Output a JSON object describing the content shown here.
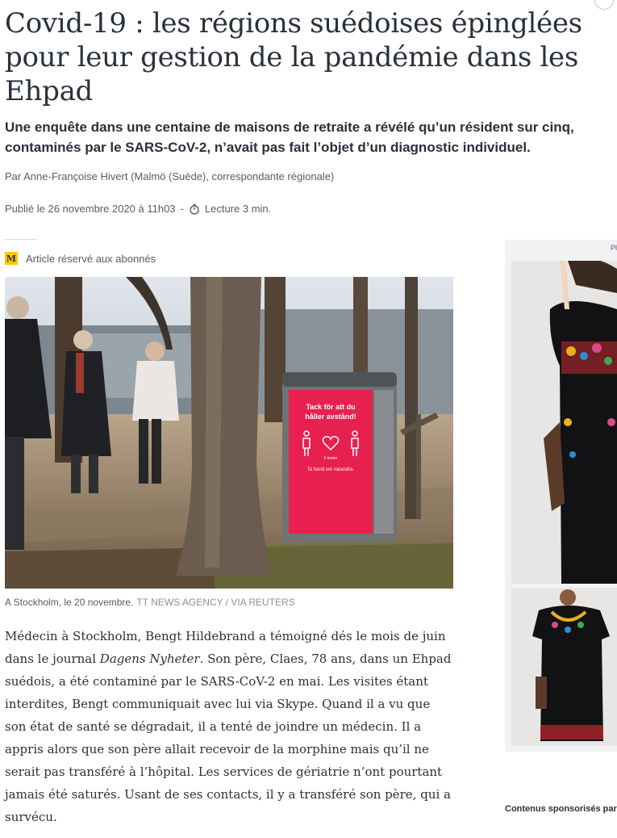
{
  "article": {
    "headline": "Covid-19 : les régions suédoises épinglées pour leur gestion de la pandémie dans les Ehpad",
    "standfirst": "Une enquête dans une centaine de maisons de retraite a révélé qu’un résident sur cinq, contaminés par le SARS-CoV-2, n’avait pas fait l’objet d’un diagnostic individuel.",
    "byline": "Par Anne-Françoise Hivert (Malmö (Suède), correspondante régionale)",
    "published": "Publié le 26 novembre 2020 à 11h03",
    "separator": "-",
    "reading_time": "Lecture 3 min.",
    "premium_badge": "M",
    "premium_label": "Article réservé aux abonnés"
  },
  "photo": {
    "caption": "A Stockholm, le 20 novembre.",
    "credit": "TT NEWS AGENCY / VIA REUTERS",
    "sign_text_1": "Tack för att du",
    "sign_text_2": "håller avstånd!",
    "sign_distance": "2 meter",
    "sign_text_3": "Ta hand om varandra."
  },
  "body": {
    "p1_before_italic": "Médecin à Stockholm, Bengt Hildebrand a témoigné dés le mois de juin dans le journal ",
    "p1_italic": "Dagens Nyheter",
    "p1_after_italic": ". Son père, Claes, 78 ans, dans un Ehpad suédois, a été contaminé par le SARS-CoV-2 en mai. Les visites étant interdites, Bengt communiquait avec lui via Skype. Quand il a vu que son état de santé se dégradait, il a tenté de joindre un médecin. Il a appris alors que son père allait recevoir de la morphine mais qu’il ne serait pas transféré à l’hôpital. Les services de gériatrie n’ont pourtant jamais été saturés. Usant de ses contacts, il y a transféré son père, qui a survécu."
  },
  "ads": {
    "label": "Pl",
    "sponsored": "Contenus sponsorisés par"
  },
  "colors": {
    "text": "#2a303b",
    "muted": "#555d68",
    "badge": "#ffc600",
    "sign_red": "#e8204f"
  }
}
